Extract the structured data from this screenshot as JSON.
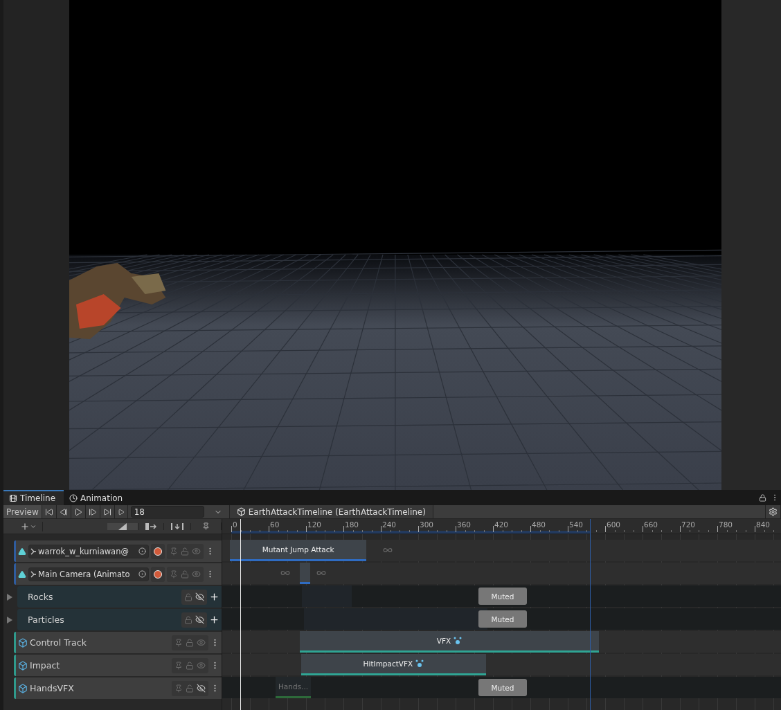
{
  "tabs": [
    {
      "label": "Timeline",
      "selected": true
    },
    {
      "label": "Animation",
      "selected": false
    }
  ],
  "toolbar": {
    "preview": "Preview",
    "frame": "18",
    "asset": "EarthAttackTimeline (EarthAttackTimeline)"
  },
  "ruler": {
    "labels": [
      "0",
      "60",
      "120",
      "180",
      "240",
      "300",
      "360",
      "420",
      "480",
      "540",
      "600",
      "660",
      "720",
      "780",
      "840"
    ]
  },
  "tracks": [
    {
      "kind": "animation",
      "name": "warrok_w_kurniawan@",
      "hidden": false,
      "clips": [
        {
          "label": "Mutant Jump Attack"
        }
      ]
    },
    {
      "kind": "animation",
      "name": "Main Camera (Animato",
      "hidden": false
    },
    {
      "kind": "group",
      "name": "Rocks",
      "expanded": false,
      "hidden": true,
      "badge": "Muted"
    },
    {
      "kind": "group",
      "name": "Particles",
      "expanded": false,
      "hidden": true,
      "badge": "Muted"
    },
    {
      "kind": "control",
      "name": "Control Track",
      "hidden": false,
      "clips": [
        {
          "label": "VFX"
        }
      ]
    },
    {
      "kind": "control",
      "name": "Impact",
      "hidden": false,
      "clips": [
        {
          "label": "HitImpactVFX"
        }
      ]
    },
    {
      "kind": "control",
      "name": "HandsVFX",
      "hidden": true,
      "badge": "Muted",
      "clips": [
        {
          "label": "Hands..."
        }
      ]
    }
  ]
}
